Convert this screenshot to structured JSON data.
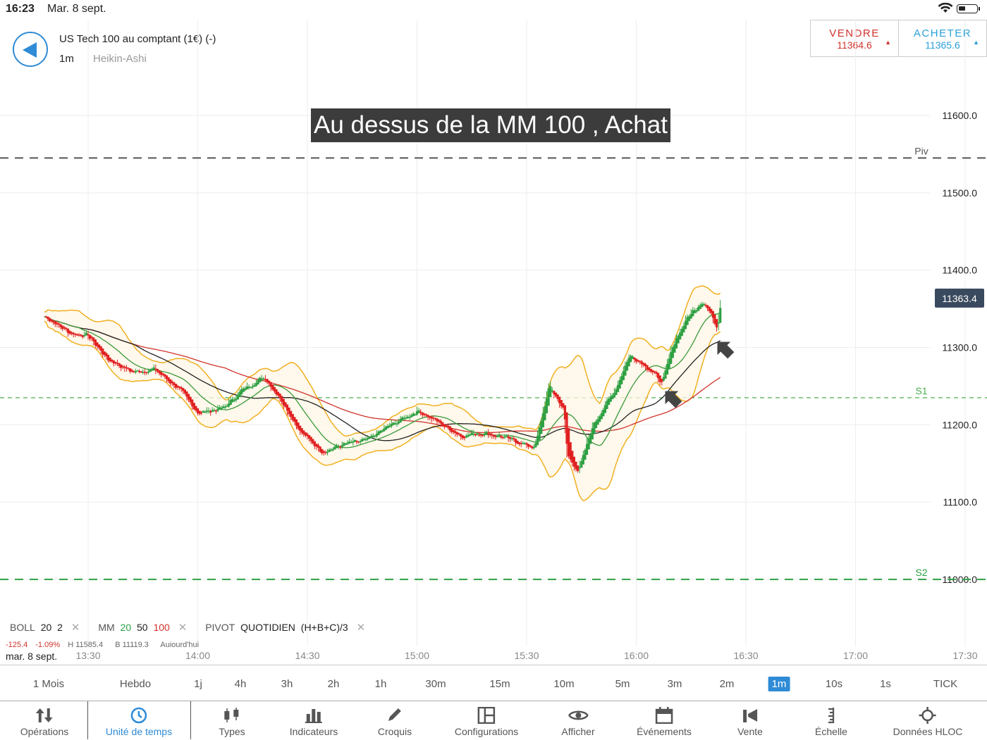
{
  "status_bar": {
    "time": "16:23",
    "date": "Mar. 8 sept."
  },
  "header": {
    "instrument": "US Tech 100 au comptant (1€) (-)",
    "timeframe": "1m",
    "chart_type": "Heikin-Ashi"
  },
  "trade": {
    "sell_label": "VENDRE",
    "sell_price": "11364.6",
    "buy_label": "ACHETER",
    "buy_price": "11365.6",
    "sell_color": "#d0342c",
    "buy_color": "#2aa0d8"
  },
  "annotation": "Au dessus de la MM 100 , Achat",
  "legend": {
    "boll": "BOLL",
    "boll_period": "20",
    "boll_dev": "2",
    "mm": "MM",
    "mm_1": "20",
    "mm_2": "50",
    "mm_3": "100",
    "pivot": "PIVOT",
    "pivot_period": "QUOTIDIEN",
    "pivot_formula": "(H+B+C)/3",
    "change": "-125.4",
    "change_pct": "-1.09%",
    "high": "H 11585.4",
    "low": "B 11119.3",
    "day": "Aujourd'hui"
  },
  "xaxis_date": "mar. 8 sept.",
  "timeframes": [
    {
      "label": "1 Mois"
    },
    {
      "label": "Hebdo"
    },
    {
      "label": "1j"
    },
    {
      "label": "4h"
    },
    {
      "label": "3h"
    },
    {
      "label": "2h"
    },
    {
      "label": "1h"
    },
    {
      "label": "30m"
    },
    {
      "label": "15m"
    },
    {
      "label": "10m"
    },
    {
      "label": "5m"
    },
    {
      "label": "3m"
    },
    {
      "label": "2m"
    },
    {
      "label": "1m"
    },
    {
      "label": "10s"
    },
    {
      "label": "1s"
    },
    {
      "label": "TICK"
    }
  ],
  "active_timeframe": "1m",
  "toolbar": [
    {
      "label": "Opérations",
      "icon": "arrows-updown-icon"
    },
    {
      "label": "Unité de temps",
      "icon": "clock-icon"
    },
    {
      "label": "Types",
      "icon": "candles-icon"
    },
    {
      "label": "Indicateurs",
      "icon": "bar-chart-icon"
    },
    {
      "label": "Croquis",
      "icon": "pencil-icon"
    },
    {
      "label": "Configurations",
      "icon": "layout-icon"
    },
    {
      "label": "Afficher",
      "icon": "eye-icon"
    },
    {
      "label": "Événements",
      "icon": "calendar-icon"
    },
    {
      "label": "Vente",
      "icon": "megaphone-icon"
    },
    {
      "label": "Échelle",
      "icon": "scale-icon"
    },
    {
      "label": "Données HLOC",
      "icon": "crosshair-icon"
    }
  ],
  "chart_data": {
    "type": "candlestick",
    "style": "Heikin-Ashi",
    "y_ticks": [
      "11600.0",
      "11500.0",
      "11400.0",
      "11300.0",
      "11200.0",
      "11100.0",
      "11000.0"
    ],
    "ylim": [
      10970,
      11680
    ],
    "x_ticks": [
      "13:30",
      "14:00",
      "14:30",
      "15:00",
      "15:30",
      "16:00",
      "16:30",
      "17:00",
      "17:30"
    ],
    "last_price": "11363.4",
    "levels": [
      {
        "name": "Piv",
        "value": 11545,
        "color": "#555555"
      },
      {
        "name": "S1",
        "value": 11235,
        "color": "#4caf50"
      },
      {
        "name": "S2",
        "value": 11000,
        "color": "#2ea043"
      }
    ],
    "anchors": [
      [
        "13:18",
        11340
      ],
      [
        "13:25",
        11318
      ],
      [
        "13:30",
        11315
      ],
      [
        "13:35",
        11285
      ],
      [
        "13:42",
        11268
      ],
      [
        "13:48",
        11272
      ],
      [
        "13:55",
        11245
      ],
      [
        "14:00",
        11215
      ],
      [
        "14:07",
        11222
      ],
      [
        "14:12",
        11245
      ],
      [
        "14:18",
        11262
      ],
      [
        "14:23",
        11230
      ],
      [
        "14:28",
        11190
      ],
      [
        "14:34",
        11165
      ],
      [
        "14:40",
        11175
      ],
      [
        "14:46",
        11180
      ],
      [
        "14:52",
        11198
      ],
      [
        "15:00",
        11218
      ],
      [
        "15:05",
        11205
      ],
      [
        "15:12",
        11185
      ],
      [
        "15:18",
        11190
      ],
      [
        "15:26",
        11180
      ],
      [
        "15:32",
        11170
      ],
      [
        "15:36",
        11250
      ],
      [
        "15:40",
        11220
      ],
      [
        "15:41",
        11160
      ],
      [
        "15:44",
        11140
      ],
      [
        "15:48",
        11200
      ],
      [
        "15:54",
        11245
      ],
      [
        "15:58",
        11290
      ],
      [
        "16:02",
        11278
      ],
      [
        "16:07",
        11255
      ],
      [
        "16:10",
        11305
      ],
      [
        "16:14",
        11340
      ],
      [
        "16:18",
        11360
      ],
      [
        "16:20",
        11345
      ],
      [
        "16:22",
        11325
      ],
      [
        "16:23",
        11363
      ]
    ]
  }
}
